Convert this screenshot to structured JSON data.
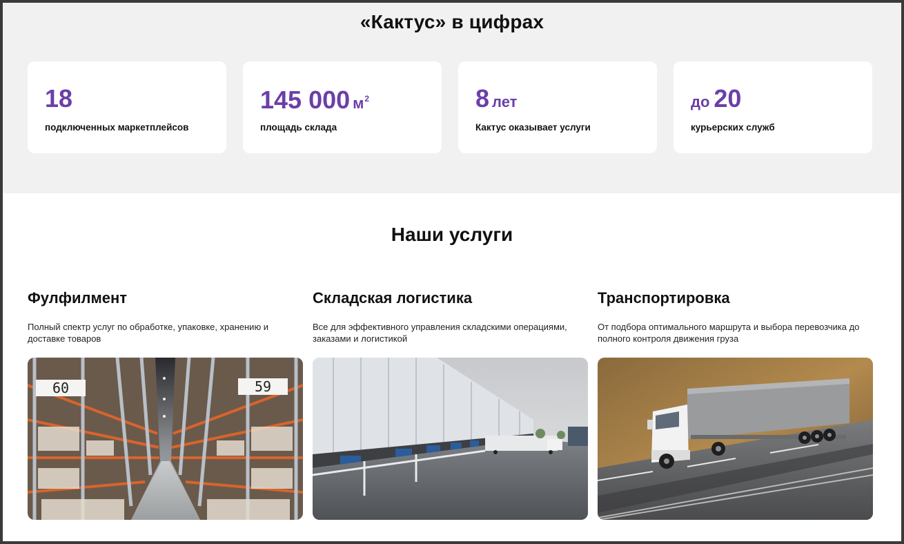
{
  "stats": {
    "title": "«Кактус» в цифрах",
    "items": [
      {
        "prefix": "",
        "value": "18",
        "unit": "",
        "sup": "",
        "label": "подключенных маркетплейсов"
      },
      {
        "prefix": "",
        "value": "145 000",
        "unit": "м",
        "sup": "2",
        "label": "площадь склада"
      },
      {
        "prefix": "",
        "value": "8",
        "unit": "лет",
        "sup": "",
        "label": "Кактус оказывает услуги"
      },
      {
        "prefix": "до",
        "value": "20",
        "unit": "",
        "sup": "",
        "label": "курьерских служб"
      }
    ]
  },
  "services": {
    "title": "Наши услуги",
    "items": [
      {
        "title": "Фулфилмент",
        "description": "Полный спектр услуг по обработке, упаковке, хранению и доставке товаров",
        "image_signs": [
          "60",
          "59"
        ]
      },
      {
        "title": "Складская логистика",
        "description": "Все для эффективного управления складскими операциями, заказами и логистикой"
      },
      {
        "title": "Транспортировка",
        "description": "От подбора оптимального маршрута и выбора перевозчика до полного контроля движения груза"
      }
    ]
  },
  "colors": {
    "accent": "#6b3fa8",
    "section_bg": "#f1f1f1",
    "card_bg": "#ffffff"
  }
}
